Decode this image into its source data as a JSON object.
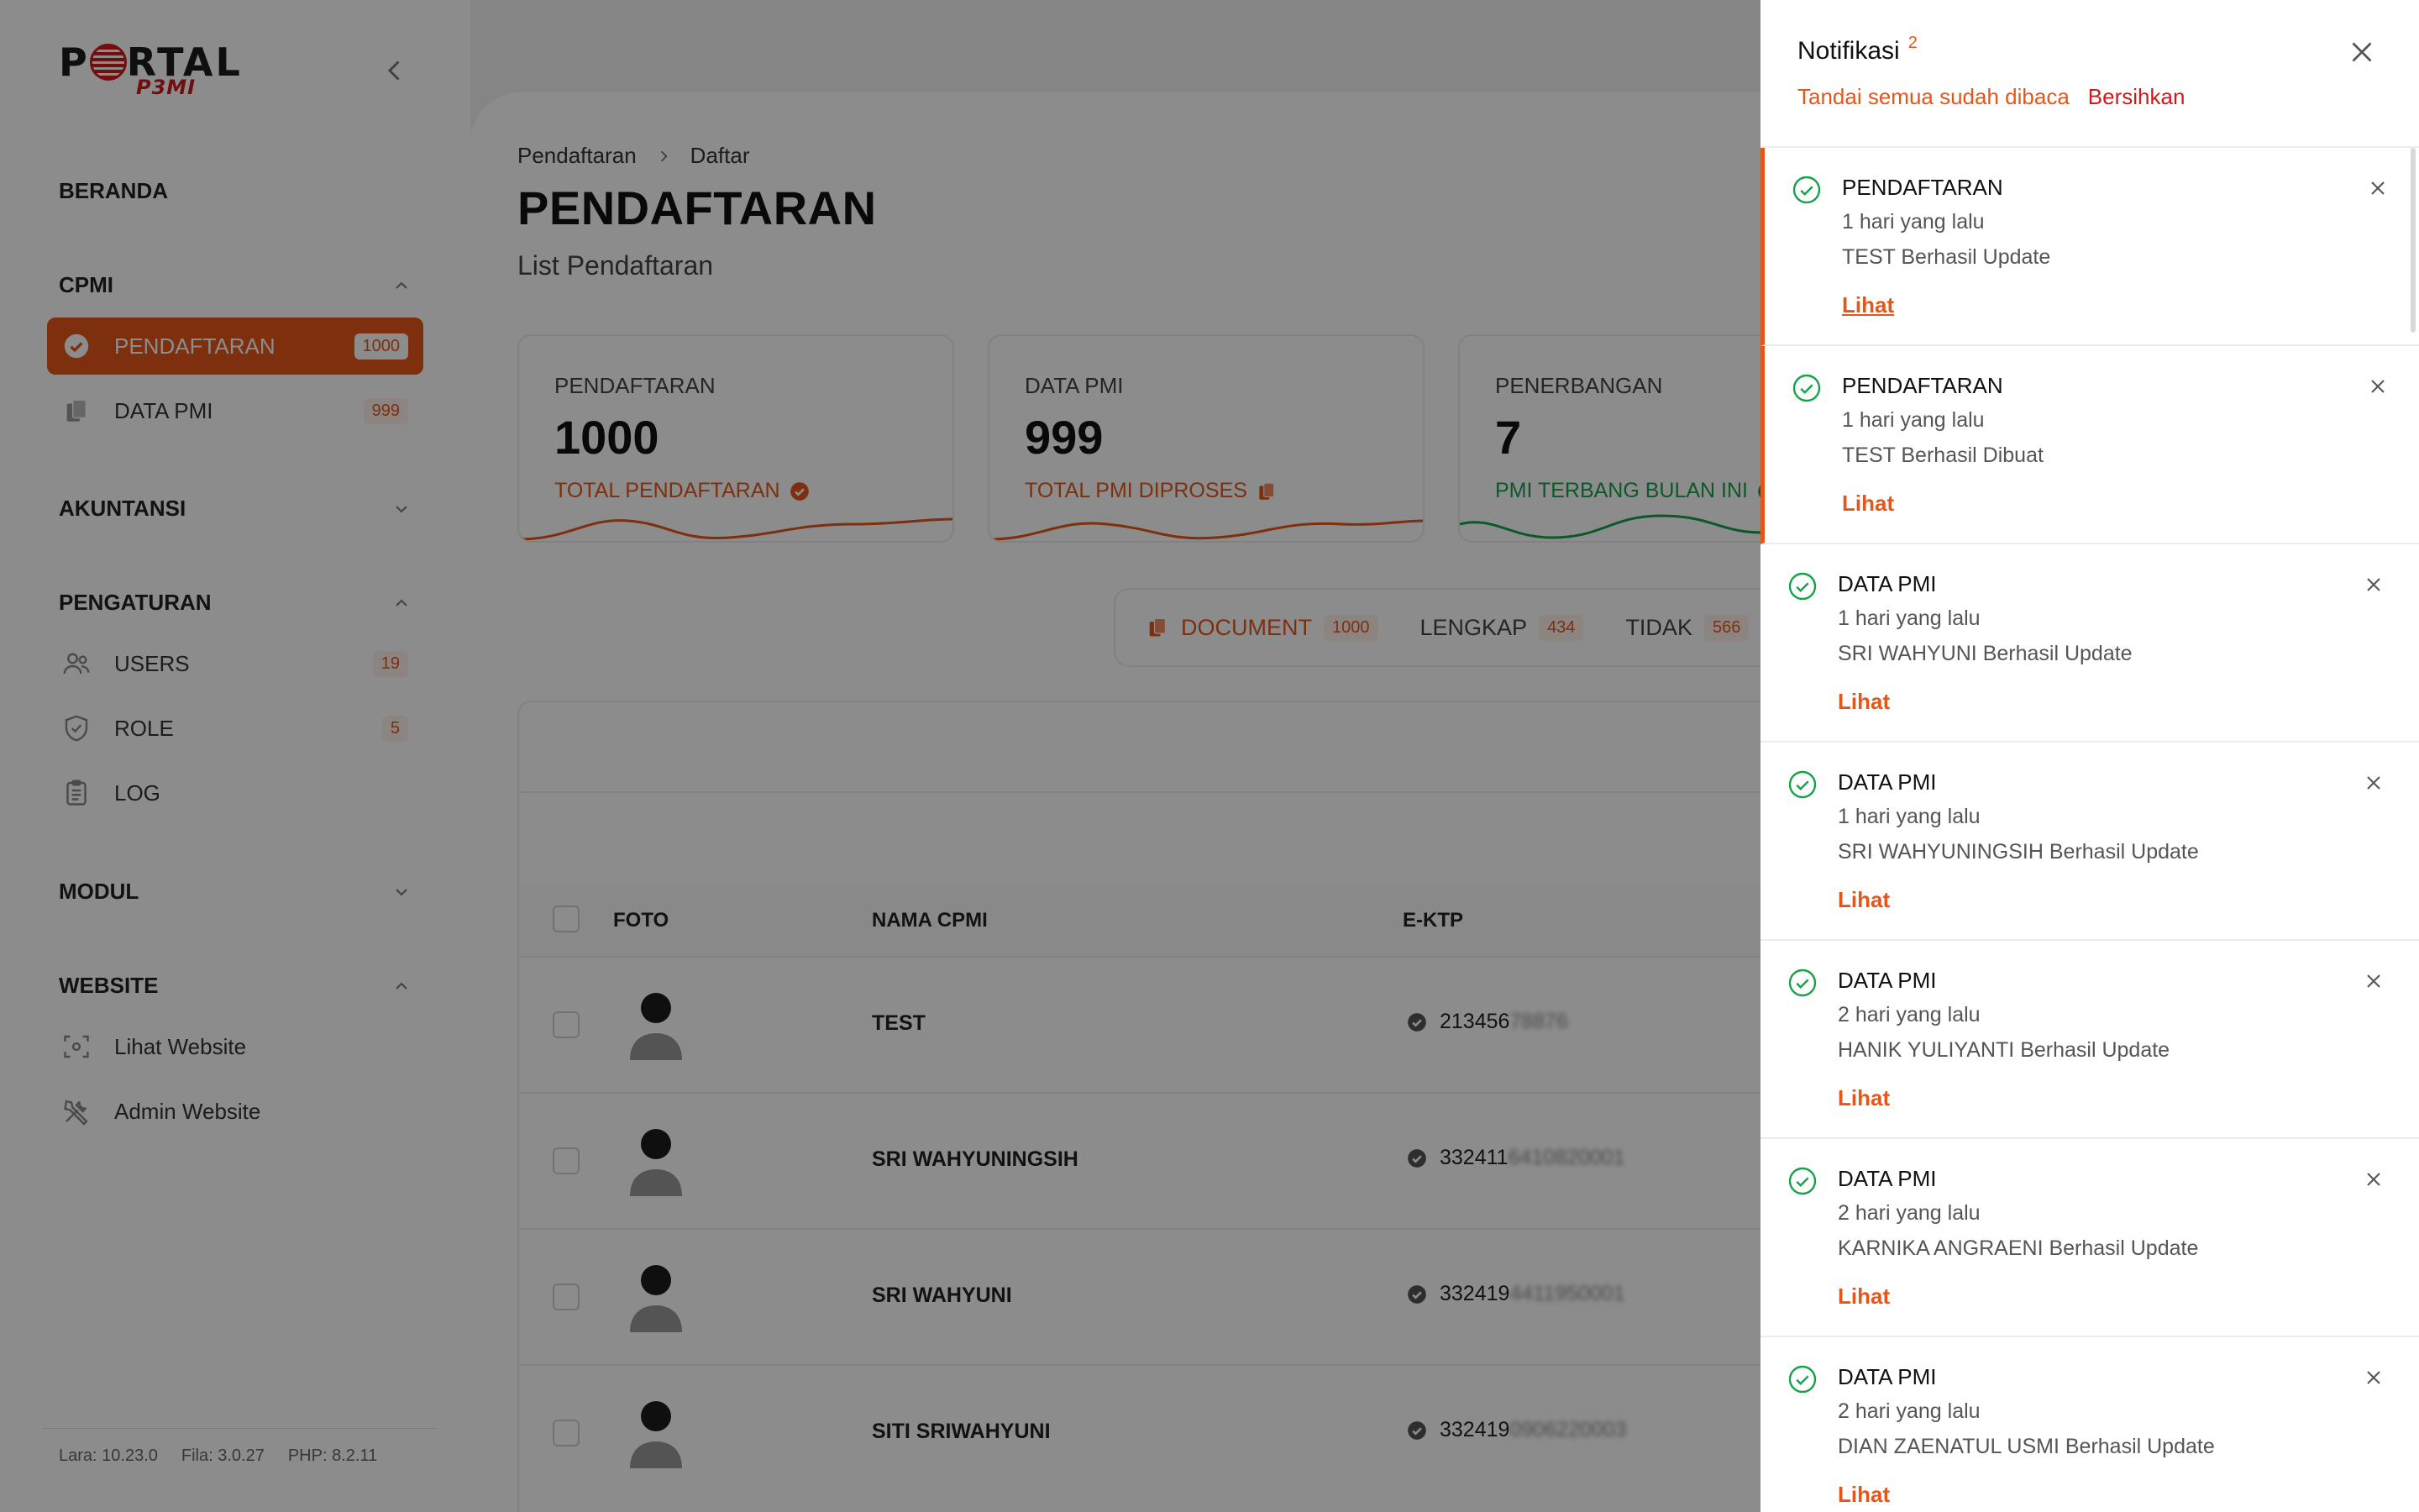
{
  "brand": {
    "name_pre": "P",
    "name_post": "RTAL",
    "sub": "P3MI"
  },
  "sidebar": {
    "home": "BERANDA",
    "sections": [
      {
        "label": "CPMI"
      },
      {
        "label": "AKUNTANSI"
      },
      {
        "label": "PENGATURAN"
      },
      {
        "label": "MODUL"
      },
      {
        "label": "WEBSITE"
      }
    ],
    "items": [
      {
        "label": "PENDAFTARAN",
        "count": "1000",
        "icon": "check-badge-icon"
      },
      {
        "label": "DATA PMI",
        "count": "999",
        "icon": "documents-icon"
      },
      {
        "label": "USERS",
        "count": "19",
        "icon": "users-icon"
      },
      {
        "label": "ROLE",
        "count": "5",
        "icon": "shield-check-icon"
      },
      {
        "label": "LOG",
        "count": "",
        "icon": "clipboard-icon"
      },
      {
        "label": "Lihat Website",
        "count": "",
        "icon": "scan-eye-icon"
      },
      {
        "label": "Admin Website",
        "count": "",
        "icon": "tools-icon"
      }
    ],
    "footer": {
      "lara": "Lara: 10.23.0",
      "fila": "Fila: 3.0.27",
      "php": "PHP: 8.2.11"
    }
  },
  "breadcrumb": [
    "Pendaftaran",
    "Daftar"
  ],
  "page": {
    "title": "PENDAFTARAN",
    "subtitle": "List Pendaftaran"
  },
  "stats": [
    {
      "label": "PENDAFTARAN",
      "value": "1000",
      "sub": "TOTAL PENDAFTARAN",
      "color": "#e4571b"
    },
    {
      "label": "DATA PMI",
      "value": "999",
      "sub": "TOTAL PMI DIPROSES",
      "color": "#e4571b"
    },
    {
      "label": "PENERBANGAN",
      "value": "7",
      "sub": "PMI TERBANG BULAN INI",
      "color": "#16a34a"
    }
  ],
  "doc_tabs": [
    {
      "label": "DOCUMENT",
      "count": "1000"
    },
    {
      "label": "LENGKAP",
      "count": "434"
    },
    {
      "label": "TIDAK",
      "count": "566"
    }
  ],
  "table": {
    "headers": {
      "foto": "FOTO",
      "nama": "NAMA CPMI",
      "ektp": "E-KTP"
    },
    "rows": [
      {
        "name": "TEST",
        "ktp": "213456",
        "ktp_hidden": "78876"
      },
      {
        "name": "SRI WAHYUNINGSIH",
        "ktp": "332411",
        "ktp_hidden": "6410820001"
      },
      {
        "name": "SRI WAHYUNI",
        "ktp": "332419",
        "ktp_hidden": "4411950001"
      },
      {
        "name": "SITI SRIWAHYUNI",
        "ktp": "332419",
        "ktp_hidden": "0906220003"
      }
    ]
  },
  "notifications": {
    "title": "Notifikasi",
    "count": "2",
    "mark_read": "Tandai semua sudah dibaca",
    "clear": "Bersihkan",
    "items": [
      {
        "title": "PENDAFTARAN",
        "time": "1 hari yang lalu",
        "message": "TEST Berhasil Update",
        "link": "Lihat"
      },
      {
        "title": "PENDAFTARAN",
        "time": "1 hari yang lalu",
        "message": "TEST Berhasil Dibuat",
        "link": "Lihat"
      },
      {
        "title": "DATA PMI",
        "time": "1 hari yang lalu",
        "message": "SRI WAHYUNI Berhasil Update",
        "link": "Lihat"
      },
      {
        "title": "DATA PMI",
        "time": "1 hari yang lalu",
        "message": "SRI WAHYUNINGSIH Berhasil Update",
        "link": "Lihat"
      },
      {
        "title": "DATA PMI",
        "time": "2 hari yang lalu",
        "message": "HANIK YULIYANTI Berhasil Update",
        "link": "Lihat"
      },
      {
        "title": "DATA PMI",
        "time": "2 hari yang lalu",
        "message": "KARNIKA ANGRAENI Berhasil Update",
        "link": "Lihat"
      },
      {
        "title": "DATA PMI",
        "time": "2 hari yang lalu",
        "message": "DIAN ZAENATUL USMI Berhasil Update",
        "link": "Lihat"
      }
    ]
  },
  "colors": {
    "accent": "#e4571b",
    "danger": "#cf1b1b",
    "success": "#16a34a"
  }
}
